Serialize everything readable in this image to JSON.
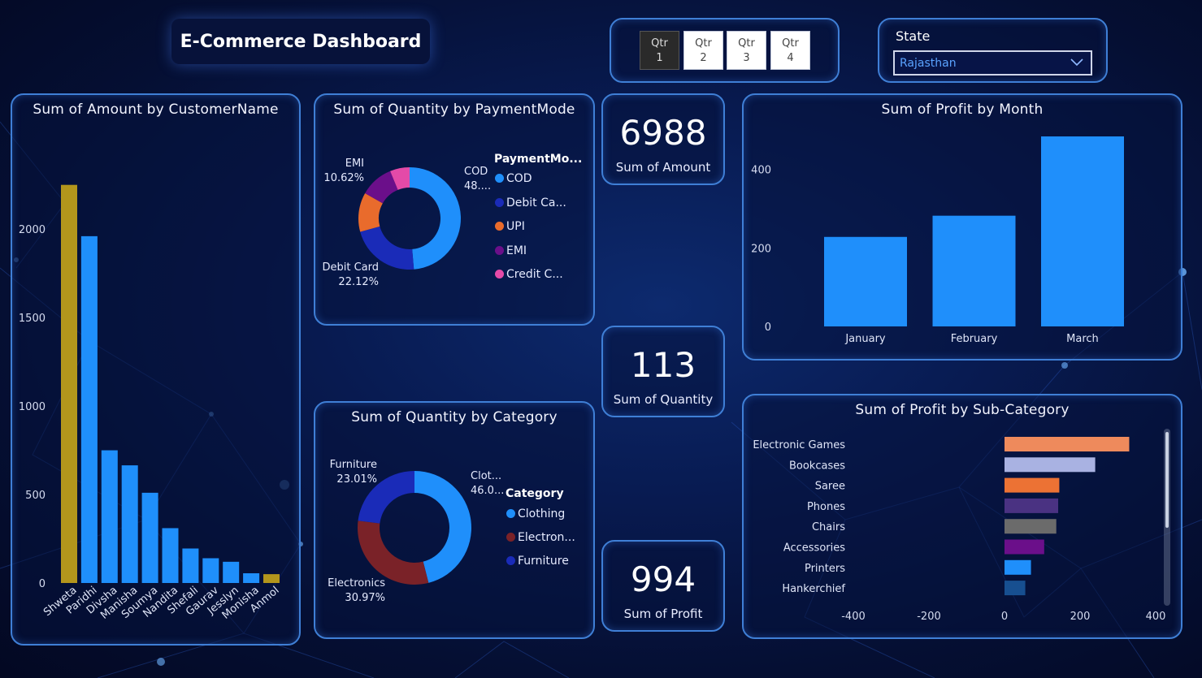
{
  "header": {
    "title": "E-Commerce Dashboard"
  },
  "quarter_slicer": {
    "items": [
      {
        "line1": "Qtr",
        "line2": "1",
        "active": true
      },
      {
        "line1": "Qtr",
        "line2": "2",
        "active": false
      },
      {
        "line1": "Qtr",
        "line2": "3",
        "active": false
      },
      {
        "line1": "Qtr",
        "line2": "4",
        "active": false
      }
    ]
  },
  "state_slicer": {
    "label": "State",
    "selected": "Rajasthan",
    "icon": "chevron-down-icon"
  },
  "kpis": {
    "amount": {
      "value": "6988",
      "label": "Sum of Amount"
    },
    "quantity": {
      "value": "113",
      "label": "Sum of Quantity"
    },
    "profit": {
      "value": "994",
      "label": "Sum of Profit"
    }
  },
  "panels": {
    "customer": {
      "title": "Sum of Amount by CustomerName"
    },
    "payment": {
      "title": "Sum of Quantity by PaymentMode",
      "legend_title": "PaymentMo..."
    },
    "category": {
      "title": "Sum of Quantity by Category",
      "legend_title": "Category"
    },
    "month": {
      "title": "Sum of Profit by Month"
    },
    "subcat": {
      "title": "Sum of Profit by Sub-Category"
    }
  },
  "colors": {
    "bar_blue": "#1f8ffb",
    "bar_gold": "#b3961c",
    "panel_border": "#3f7fd6",
    "background": "#081b52"
  },
  "chart_data": [
    {
      "id": "customer",
      "type": "bar",
      "categories": [
        "Shweta",
        "Paridhi",
        "Divsha",
        "Manisha",
        "Soumya",
        "Nandita",
        "Shefali",
        "Gaurav",
        "Jesslyn",
        "Monisha",
        "Anmol"
      ],
      "values": [
        2250,
        1960,
        750,
        665,
        510,
        310,
        195,
        140,
        120,
        55,
        50
      ],
      "highlight": [
        "Shweta",
        "Anmol"
      ],
      "yticks": [
        "0",
        "500",
        "1000",
        "1500",
        "2000"
      ],
      "ylim": [
        0,
        2400
      ]
    },
    {
      "id": "payment",
      "type": "pie",
      "donut": true,
      "labels": [
        "COD",
        "Debit Card",
        "UPI",
        "EMI",
        "Credit Card"
      ],
      "legend_labels": [
        "COD",
        "Debit Ca...",
        "UPI",
        "EMI",
        "Credit C..."
      ],
      "values": [
        48.67,
        22.12,
        12.39,
        10.62,
        6.2
      ],
      "colors": [
        "#1f8ffb",
        "#1a2bb8",
        "#e96b2c",
        "#6b0f8a",
        "#e44aa8"
      ],
      "data_labels": [
        {
          "slice": "COD",
          "line1": "COD",
          "line2": "48...."
        },
        {
          "slice": "EMI",
          "line1": "EMI",
          "line2": "10.62%"
        },
        {
          "slice": "Debit Card",
          "line1": "Debit Card",
          "line2": "22.12%"
        }
      ]
    },
    {
      "id": "category",
      "type": "pie",
      "donut": true,
      "labels": [
        "Clothing",
        "Electronics",
        "Furniture"
      ],
      "legend_labels": [
        "Clothing",
        "Electron...",
        "Furniture"
      ],
      "values": [
        46.02,
        30.97,
        23.01
      ],
      "colors": [
        "#1f8ffb",
        "#7a2228",
        "#1a2bb8"
      ],
      "data_labels": [
        {
          "slice": "Clothing",
          "line1": "Clot...",
          "line2": "46.0..."
        },
        {
          "slice": "Furniture",
          "line1": "Furniture",
          "line2": "23.01%"
        },
        {
          "slice": "Electronics",
          "line1": "Electronics",
          "line2": "30.97%"
        }
      ]
    },
    {
      "id": "month",
      "type": "bar",
      "categories": [
        "January",
        "February",
        "March"
      ],
      "values": [
        228,
        282,
        484
      ],
      "yticks": [
        "0",
        "200",
        "400"
      ],
      "ylim": [
        0,
        484
      ]
    },
    {
      "id": "subcat",
      "type": "bar",
      "orientation": "horizontal",
      "categories": [
        "Electronic Games",
        "Bookcases",
        "Saree",
        "Phones",
        "Chairs",
        "Accessories",
        "Printers",
        "Hankerchief"
      ],
      "values": [
        330,
        240,
        145,
        142,
        137,
        105,
        70,
        55
      ],
      "colors": [
        "#ee8a5c",
        "#a9b2e2",
        "#ec7234",
        "#4a3282",
        "#6b6b6b",
        "#6b0f8a",
        "#1f8ffb",
        "#174f90"
      ],
      "xticks": [
        "-400",
        "-200",
        "0",
        "200",
        "400"
      ],
      "xlim": [
        -400,
        400
      ]
    }
  ]
}
